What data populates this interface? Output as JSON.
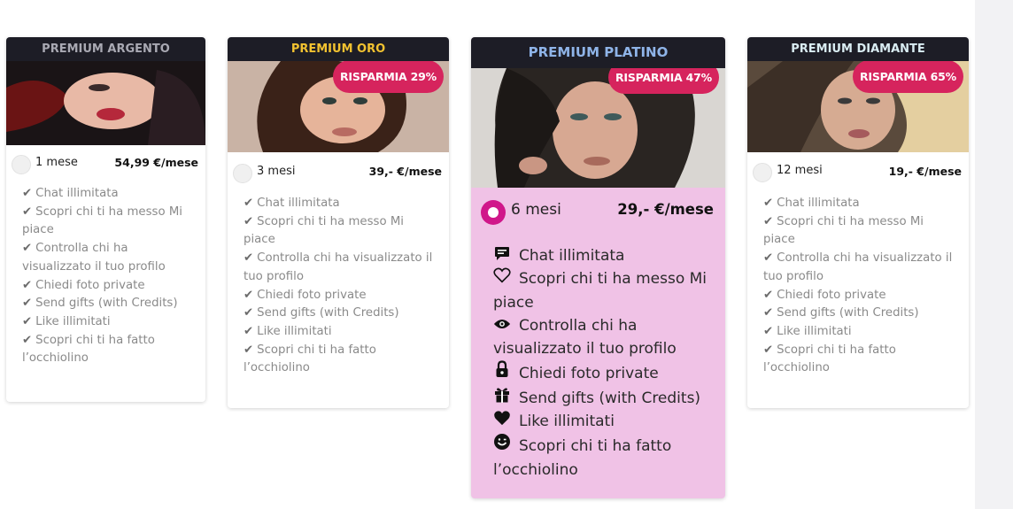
{
  "cards": [
    {
      "title": "PREMIUM ARGENTO",
      "title_color": "#a9a9b3",
      "badge": "",
      "months": "1 mese",
      "price": "54,99 €/mese",
      "selected": false,
      "features": [
        "Chat illimitata",
        "Scopri chi ti ha messo Mi piace",
        "Controlla chi ha visualizzato il tuo profilo",
        "Chiedi foto private",
        "Send gifts (with Credits)",
        "Like illimitati",
        "Scopri chi ti ha fatto l’occhiolino"
      ]
    },
    {
      "title": "PREMIUM ORO",
      "title_color": "#f2c230",
      "badge": "RISPARMIA 29%",
      "months": "3 mesi",
      "price": "39,- €/mese",
      "selected": false,
      "features": [
        "Chat illimitata",
        "Scopri chi ti ha messo Mi piace",
        "Controlla chi ha visualizzato il tuo profilo",
        "Chiedi foto private",
        "Send gifts (with Credits)",
        "Like illimitati",
        "Scopri chi ti ha fatto l’occhiolino"
      ]
    },
    {
      "title": "PREMIUM PLATINO",
      "title_color": "#8fb4e8",
      "badge": "RISPARMIA 47%",
      "months": "6 mesi",
      "price": "29,- €/mese",
      "selected": true,
      "features": [
        "Chat illimitata",
        "Scopri chi ti ha messo Mi piace",
        "Controlla chi ha visualizzato il tuo profilo",
        "Chiedi foto private",
        "Send gifts (with Credits)",
        "Like illimitati",
        "Scopri chi ti ha fatto l’occhiolino"
      ],
      "feature_icons": [
        "chat-icon",
        "heart-outline-icon",
        "eye-icon",
        "lock-icon",
        "gift-icon",
        "heart-icon",
        "smile-icon"
      ]
    },
    {
      "title": "PREMIUM DIAMANTE",
      "title_color": "#d9ecf2",
      "badge": "RISPARMIA 65%",
      "months": "12 mesi",
      "price": "19,- €/mese",
      "selected": false,
      "features": [
        "Chat illimitata",
        "Scopri chi ti ha messo Mi piace",
        "Controlla chi ha visualizzato il tuo profilo",
        "Chiedi foto private",
        "Send gifts (with Credits)",
        "Like illimitati",
        "Scopri chi ti ha fatto l’occhiolino"
      ]
    }
  ],
  "colors": {
    "badge": "#d6245d",
    "header_bg": "#1d1d26",
    "featured_bg": "#f0c2e6",
    "radio_selected": "#d0178a"
  }
}
